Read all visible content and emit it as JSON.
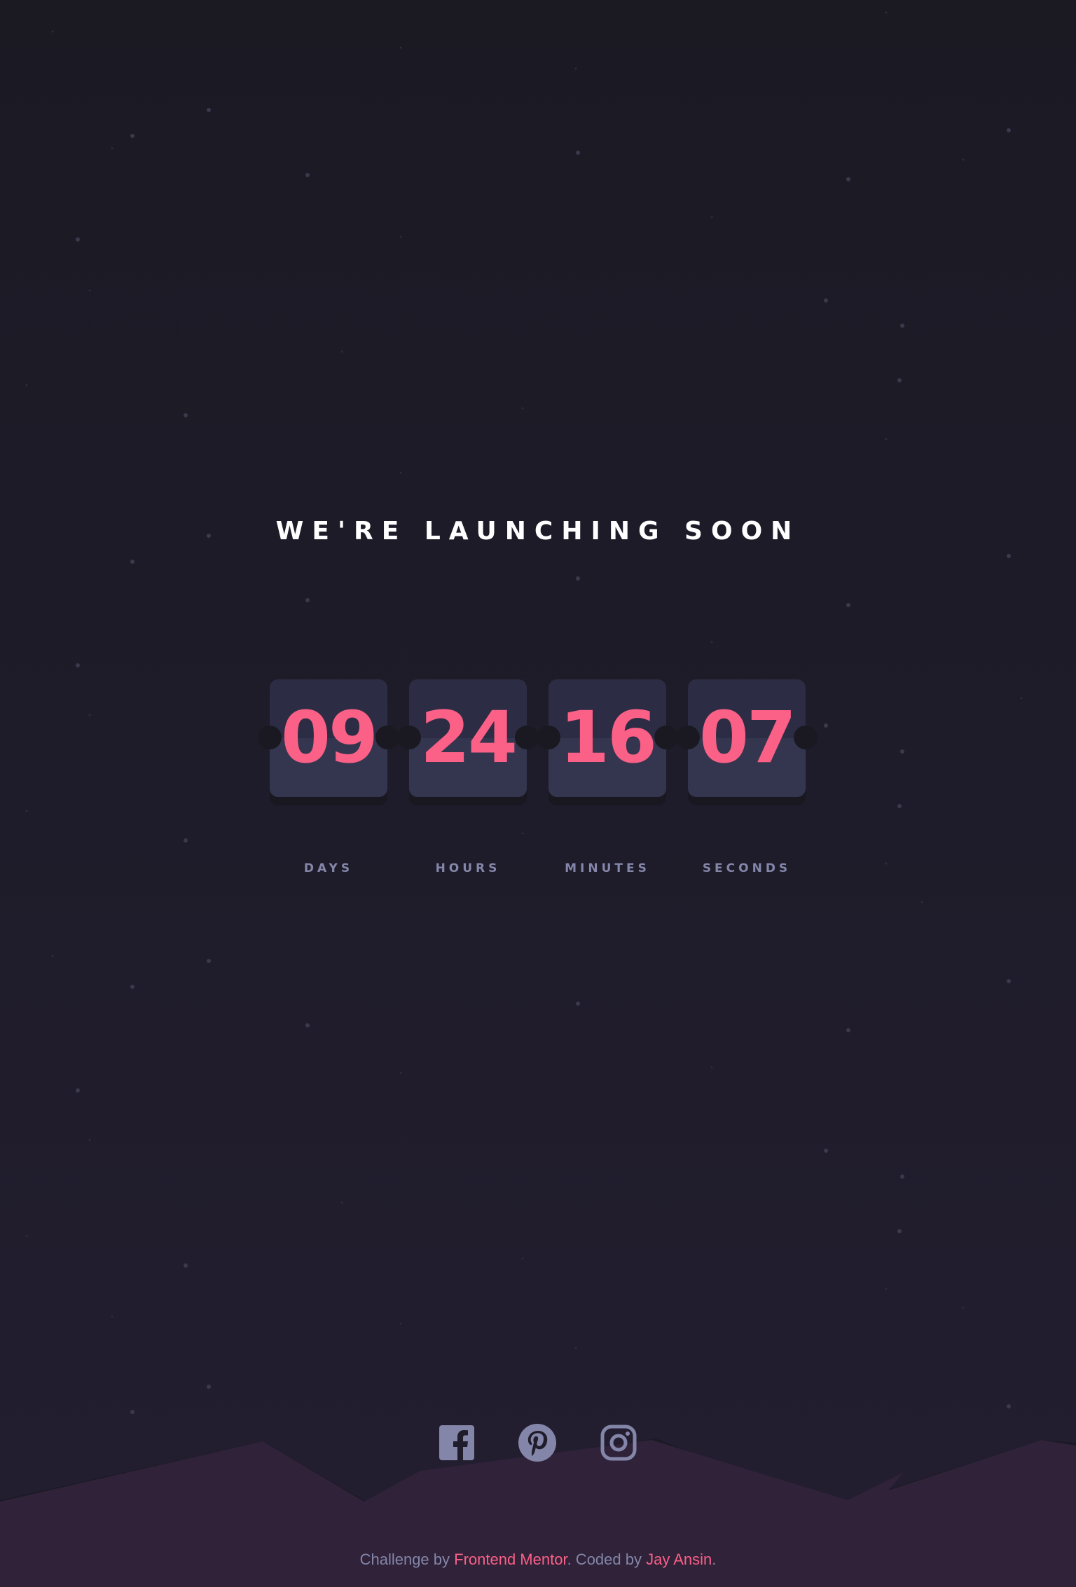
{
  "heading": "WE'RE LAUNCHING SOON",
  "countdown": [
    {
      "value": "09",
      "label": "DAYS"
    },
    {
      "value": "24",
      "label": "HOURS"
    },
    {
      "value": "16",
      "label": "MINUTES"
    },
    {
      "value": "07",
      "label": "SECONDS"
    }
  ],
  "social": [
    "facebook-icon",
    "pinterest-icon",
    "instagram-icon"
  ],
  "footer": {
    "prefix": "Challenge by ",
    "link1": "Frontend Mentor",
    "middle": ". Coded by ",
    "link2": "Jay Ansin",
    "suffix": "."
  },
  "colors": {
    "accent": "#fb6087",
    "muted": "#8486a9",
    "card_top": "#2c2c44",
    "card_bottom": "#34364f",
    "hills": "#2f2239"
  }
}
